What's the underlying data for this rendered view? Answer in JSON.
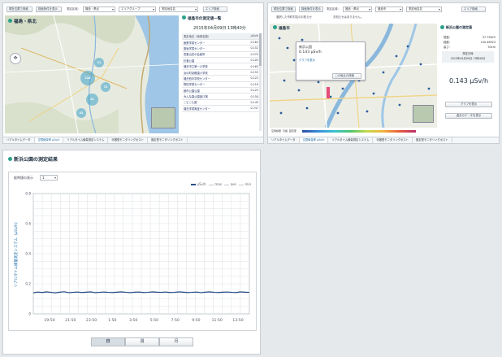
{
  "left_panel": {
    "toolbar": {
      "btn1": "現在位置で検索",
      "btn2": "検索条件を表示",
      "filter_label": "測定区域：",
      "prefecture": "福島・県北",
      "group": "エリアグループ",
      "area_placeholder": "測定地名名",
      "search_btn": "エリア検索"
    },
    "map_title": "福島・県北",
    "clusters": [
      "116",
      "11",
      "21",
      "72",
      "41"
    ],
    "list": {
      "title": "福島市の測定値一覧",
      "datetime": "2015年04月09日 13時40分",
      "col_name": "測定地名（地域名順）",
      "col_value": "μSv/h",
      "rows": [
        {
          "name": "飯野学習センター",
          "value": "0.163"
        },
        {
          "name": "庭坂学習センター",
          "value": "0.152"
        },
        {
          "name": "吾妻山荘の会議所",
          "value": "0.275"
        },
        {
          "name": "杉妻公園",
          "value": "0.105"
        },
        {
          "name": "福島市立第一小学校",
          "value": "0.163"
        },
        {
          "name": "浜の町幼稚園小学校",
          "value": "0.155"
        },
        {
          "name": "福島西中学校センター",
          "value": "0.123"
        },
        {
          "name": "野田学習センター",
          "value": "0.118"
        },
        {
          "name": "都市公園公園",
          "value": "0.125"
        },
        {
          "name": "みんな森公園遊び場",
          "value": "0.150"
        },
        {
          "name": "こむこむ館",
          "value": "0.145"
        },
        {
          "name": "福島学習実証センター",
          "value": "0.747"
        }
      ]
    },
    "tabs": [
      "リアルタイムデータ",
      "空間線量率 μSv/h",
      "リアルタイム線量測定システム",
      "可搬型モニタリングポスト",
      "固定型モニタリングポスト"
    ]
  },
  "right_panel": {
    "toolbar": {
      "btn1": "現在位置で検索",
      "btn2": "検索条件を表示",
      "filter_label": "測定区域：",
      "prefecture": "福島・県北",
      "city": "福島市",
      "place": "測定地名名",
      "search_btn": "エリア検索"
    },
    "notice_label": "選択した市町村名のお知らせ",
    "notice_value": "お知らせはありません。",
    "map_title": "福島市",
    "popup": {
      "name": "新浜公園",
      "value": "0.143 μSv/h",
      "link": "グラフを表示",
      "btn": "この地点の詳細"
    },
    "legend_items": [
      "空間線量",
      "可搬",
      "固定型"
    ],
    "detail": {
      "title": "新浜公園の測定値",
      "lat_label": "緯度：",
      "lat": "37.75625",
      "lon_label": "経度：",
      "lon": "140.46923",
      "height_label": "高さ：",
      "height": "50cm",
      "time_label": "測定日時",
      "time": "2015年04月09日 13時40分",
      "value": "0.143 μSv/h",
      "btn_graph": "グラフを表示",
      "btn_other": "過去のデータを表示"
    },
    "tabs": [
      "リアルタイムデータ",
      "空間線量率 μSv/h",
      "リアルタイム線量測定システム",
      "可搬型モニタリングポスト",
      "固定型モニタリングポスト"
    ]
  },
  "result": {
    "title": "新浜公園の測定結果",
    "unit_label": "経時値の表示",
    "unit_value": "1",
    "legend": [
      "μSv/h",
      "max",
      "ave",
      "min"
    ],
    "period_buttons": [
      "日",
      "週",
      "月"
    ],
    "colors": {
      "line": "#2a4f8a",
      "grid": "#dfe3e7"
    }
  },
  "chart_data": {
    "type": "line",
    "ylabel": "リアルタイム線量測定システム（μSv/h）",
    "ylim": [
      0,
      0.8
    ],
    "yticks": [
      "0.8",
      "0.6",
      "0.4",
      "0.2",
      "0"
    ],
    "x": [
      "19:50",
      "21:50",
      "23:50",
      "1:50",
      "3:50",
      "5:50",
      "7:50",
      "9:50",
      "11:50",
      "13:50"
    ],
    "series": [
      {
        "name": "μSv/h",
        "values": [
          0.14,
          0.145,
          0.142,
          0.146,
          0.143,
          0.14,
          0.144,
          0.147,
          0.141,
          0.143,
          0.145,
          0.142,
          0.144,
          0.146,
          0.141,
          0.143,
          0.145,
          0.143,
          0.142,
          0.144,
          0.146,
          0.143,
          0.141,
          0.144,
          0.145,
          0.142,
          0.143,
          0.146,
          0.144,
          0.143,
          0.145,
          0.142,
          0.143,
          0.146,
          0.144,
          0.142,
          0.143,
          0.145,
          0.141,
          0.144,
          0.146,
          0.143,
          0.142,
          0.144,
          0.145,
          0.143,
          0.142,
          0.146,
          0.144,
          0.143
        ]
      }
    ]
  }
}
